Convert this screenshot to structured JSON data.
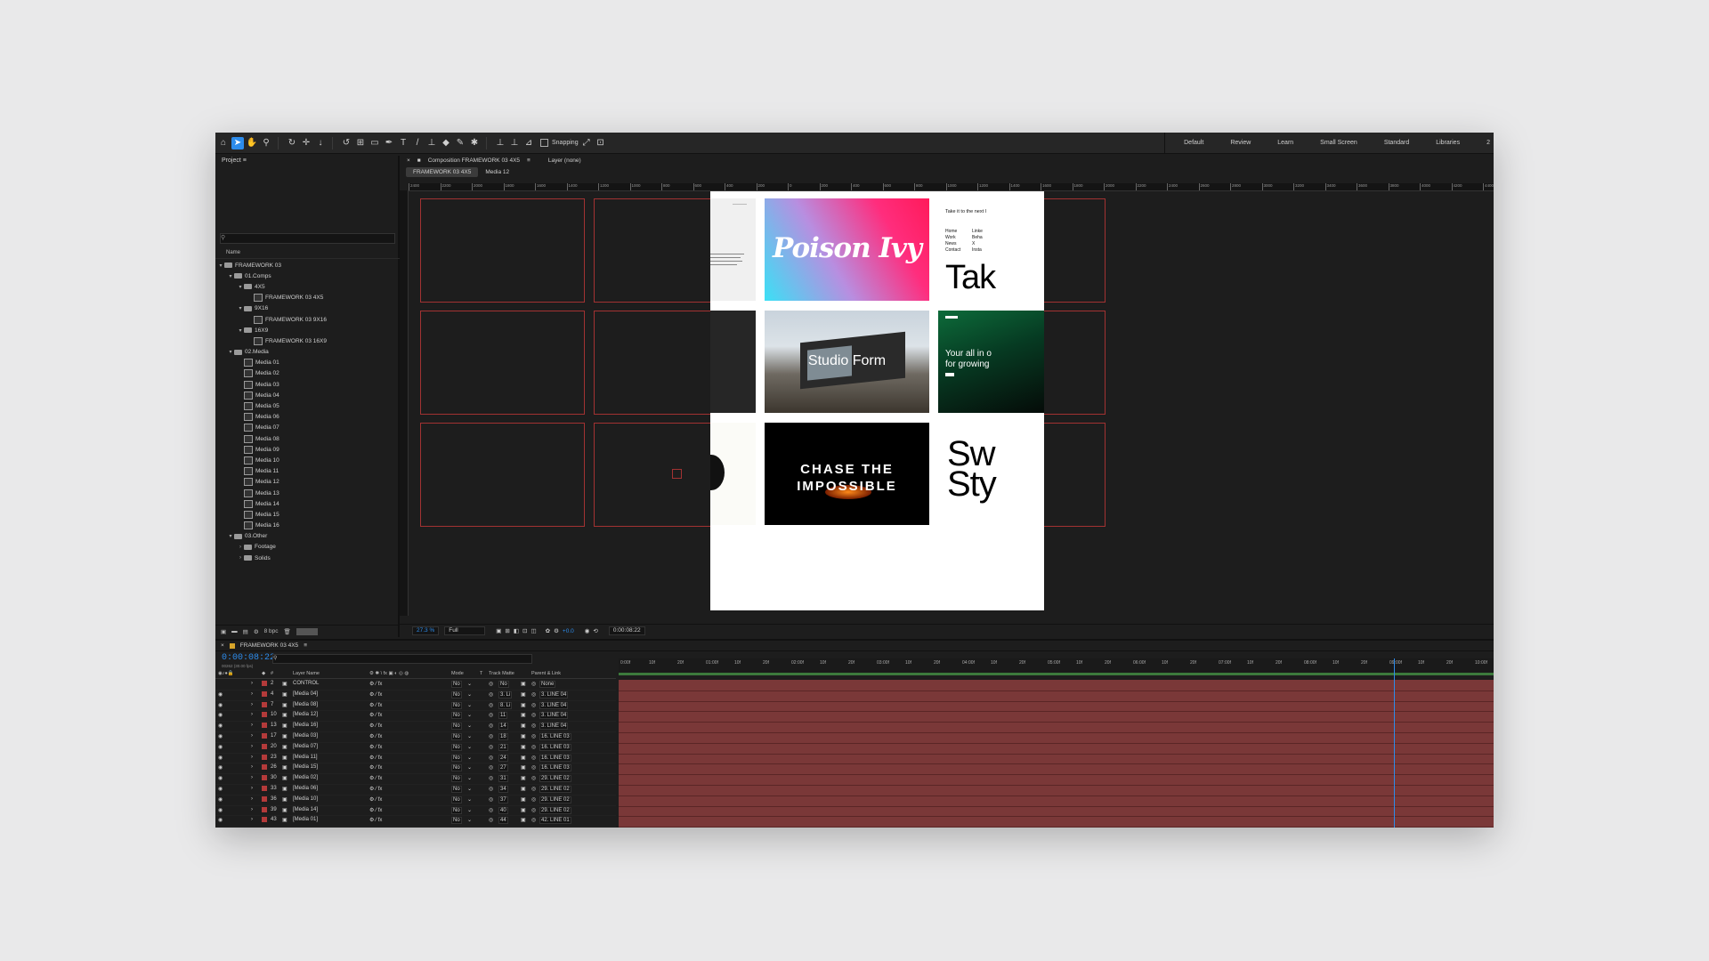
{
  "toolbar": {
    "snapping_label": "Snapping",
    "tools": [
      "home-icon",
      "selection-tool-icon",
      "hand-tool-icon",
      "zoom-tool-icon",
      "orbit-camera-icon",
      "pan-camera-icon",
      "dolly-camera-icon",
      "rotate-tool-icon",
      "anchor-point-icon",
      "rectangle-tool-icon",
      "pen-tool-icon",
      "type-tool-icon",
      "brush-tool-icon",
      "clone-stamp-icon",
      "eraser-tool-icon",
      "roto-brush-icon",
      "puppet-pin-icon"
    ],
    "workspaces": [
      "Default",
      "Review",
      "Learn",
      "Small Screen",
      "Standard",
      "Libraries",
      "2"
    ]
  },
  "project": {
    "tab": "Project",
    "name_header": "Name",
    "tree": [
      {
        "label": "FRAMEWORK 03",
        "depth": 0,
        "type": "folder",
        "open": true
      },
      {
        "label": "01.Comps",
        "depth": 1,
        "type": "folder",
        "open": true
      },
      {
        "label": "4X5",
        "depth": 2,
        "type": "folder",
        "open": true
      },
      {
        "label": "FRAMEWORK 03 4X5",
        "depth": 3,
        "type": "comp"
      },
      {
        "label": "9X16",
        "depth": 2,
        "type": "folder",
        "open": true
      },
      {
        "label": "FRAMEWORK 03 9X16",
        "depth": 3,
        "type": "comp"
      },
      {
        "label": "16X9",
        "depth": 2,
        "type": "folder",
        "open": true
      },
      {
        "label": "FRAMEWORK 03 16X9",
        "depth": 3,
        "type": "comp"
      },
      {
        "label": "02.Media",
        "depth": 1,
        "type": "folder",
        "open": true
      },
      {
        "label": "Media 01",
        "depth": 2,
        "type": "comp"
      },
      {
        "label": "Media 02",
        "depth": 2,
        "type": "comp"
      },
      {
        "label": "Media 03",
        "depth": 2,
        "type": "comp"
      },
      {
        "label": "Media 04",
        "depth": 2,
        "type": "comp"
      },
      {
        "label": "Media 05",
        "depth": 2,
        "type": "comp"
      },
      {
        "label": "Media 06",
        "depth": 2,
        "type": "comp"
      },
      {
        "label": "Media 07",
        "depth": 2,
        "type": "comp"
      },
      {
        "label": "Media 08",
        "depth": 2,
        "type": "comp"
      },
      {
        "label": "Media 09",
        "depth": 2,
        "type": "comp"
      },
      {
        "label": "Media 10",
        "depth": 2,
        "type": "comp"
      },
      {
        "label": "Media 11",
        "depth": 2,
        "type": "comp"
      },
      {
        "label": "Media 12",
        "depth": 2,
        "type": "comp"
      },
      {
        "label": "Media 13",
        "depth": 2,
        "type": "comp"
      },
      {
        "label": "Media 14",
        "depth": 2,
        "type": "comp"
      },
      {
        "label": "Media 15",
        "depth": 2,
        "type": "comp"
      },
      {
        "label": "Media 16",
        "depth": 2,
        "type": "comp"
      },
      {
        "label": "03.Other",
        "depth": 1,
        "type": "folder",
        "open": true
      },
      {
        "label": "Footage",
        "depth": 2,
        "type": "folder",
        "open": false
      },
      {
        "label": "Solids",
        "depth": 2,
        "type": "folder",
        "open": false
      }
    ],
    "bpc": "8 bpc"
  },
  "composition": {
    "panel_title": "Composition FRAMEWORK 03 4X5",
    "layer_panel": "Layer (none)",
    "tabs": [
      "FRAMEWORK 03 4X5",
      "Media 12"
    ],
    "ruler_ticks": [
      "2400",
      "2200",
      "2000",
      "1800",
      "1600",
      "1400",
      "1200",
      "1000",
      "800",
      "600",
      "400",
      "200",
      "0",
      "200",
      "400",
      "600",
      "800",
      "1000",
      "1200",
      "1400",
      "1600",
      "1800",
      "2000",
      "2200",
      "2400",
      "2600",
      "2800",
      "3000",
      "3200",
      "3400",
      "3600",
      "3800",
      "4000",
      "4200",
      "4400"
    ],
    "zoom": "27.3 %",
    "resolution": "Full",
    "exposure": "+0.0",
    "timecode": "0:00:08:22",
    "cards": {
      "poison_ivy": "Poison Ivy",
      "studio_form": "Studio Form",
      "chase": "CHASE THE",
      "impossible": "IMPOSSIBLE",
      "take_heading": "Take it to the next l",
      "menu": [
        "Home",
        "Work",
        "News",
        "Contact"
      ],
      "menu2": [
        "Linke",
        "Beha",
        "X",
        "Insta"
      ],
      "tak": "Tak",
      "your_all": "Your all in o",
      "for_growing": "for growing",
      "sw": "Sw",
      "sty": "Sty"
    }
  },
  "timeline": {
    "tab": "FRAMEWORK 03 4X5",
    "timecode": "0:00:08:22",
    "timecode_sub": "00262 (30.00 fps)",
    "headers": {
      "layer_name": "Layer Name",
      "mode": "Mode",
      "t": "T",
      "track_matte": "Track Matte",
      "parent": "Parent & Link"
    },
    "ruler": [
      "0:00f",
      "10f",
      "20f",
      "01:00f",
      "10f",
      "20f",
      "02:00f",
      "10f",
      "20f",
      "03:00f",
      "10f",
      "20f",
      "04:00f",
      "10f",
      "20f",
      "05:00f",
      "10f",
      "20f",
      "06:00f",
      "10f",
      "20f",
      "07:00f",
      "10f",
      "20f",
      "08:00f",
      "10f",
      "20f",
      "09:00f",
      "10f",
      "20f",
      "10:00f"
    ],
    "playhead": 0.886,
    "layers": [
      {
        "num": "2",
        "name": "CONTROL",
        "mode": "No",
        "matte": "No",
        "parent": "None"
      },
      {
        "num": "4",
        "name": "[Media 04]",
        "mode": "No",
        "matte": "3. Li",
        "parent": "3. LINE 04"
      },
      {
        "num": "7",
        "name": "[Media 08]",
        "mode": "No",
        "matte": "8. Li",
        "parent": "3. LINE 04"
      },
      {
        "num": "10",
        "name": "[Media 12]",
        "mode": "No",
        "matte": "11",
        "parent": "3. LINE 04"
      },
      {
        "num": "13",
        "name": "[Media 16]",
        "mode": "No",
        "matte": "14",
        "parent": "3. LINE 04"
      },
      {
        "num": "17",
        "name": "[Media 03]",
        "mode": "No",
        "matte": "18",
        "parent": "16. LINE 03"
      },
      {
        "num": "20",
        "name": "[Media 07]",
        "mode": "No",
        "matte": "21",
        "parent": "16. LINE 03"
      },
      {
        "num": "23",
        "name": "[Media 11]",
        "mode": "No",
        "matte": "24",
        "parent": "16. LINE 03"
      },
      {
        "num": "26",
        "name": "[Media 15]",
        "mode": "No",
        "matte": "27",
        "parent": "16. LINE 03"
      },
      {
        "num": "30",
        "name": "[Media 02]",
        "mode": "No",
        "matte": "31",
        "parent": "29. LINE 02"
      },
      {
        "num": "33",
        "name": "[Media 06]",
        "mode": "No",
        "matte": "34",
        "parent": "29. LINE 02"
      },
      {
        "num": "36",
        "name": "[Media 10]",
        "mode": "No",
        "matte": "37",
        "parent": "29. LINE 02"
      },
      {
        "num": "39",
        "name": "[Media 14]",
        "mode": "No",
        "matte": "40",
        "parent": "29. LINE 02"
      },
      {
        "num": "43",
        "name": "[Media 01]",
        "mode": "No",
        "matte": "44",
        "parent": "42. LINE 01"
      },
      {
        "num": "46",
        "name": "[Media 05]",
        "mode": "No",
        "matte": "47",
        "parent": "42. LINE 01"
      }
    ]
  },
  "colors": {
    "accent": "#2d8ceb",
    "label_red": "#b43a3a",
    "track": "#7a3838",
    "frame": "#a23232"
  }
}
